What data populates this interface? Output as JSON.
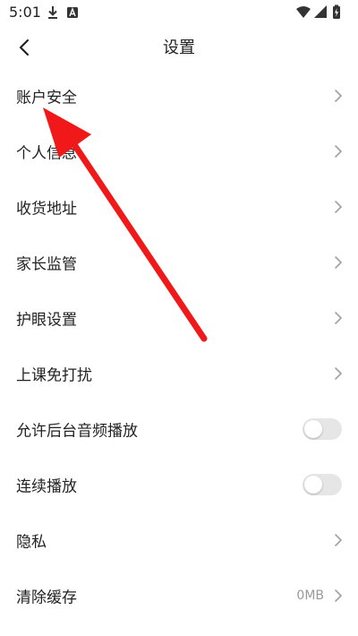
{
  "status_bar": {
    "time": "5:01",
    "icons": [
      "download-icon",
      "a-badge-icon",
      "wifi-icon",
      "signal-icon",
      "battery-charging-icon"
    ]
  },
  "header": {
    "back_icon": "chevron-left-icon",
    "title": "设置"
  },
  "settings": {
    "items": [
      {
        "label": "账户安全",
        "control": "chevron"
      },
      {
        "label": "个人信息",
        "control": "chevron"
      },
      {
        "label": "收货地址",
        "control": "chevron"
      },
      {
        "label": "家长监管",
        "control": "chevron"
      },
      {
        "label": "护眼设置",
        "control": "chevron"
      },
      {
        "label": "上课免打扰",
        "control": "chevron"
      },
      {
        "label": "允许后台音频播放",
        "control": "toggle",
        "enabled": false
      },
      {
        "label": "连续播放",
        "control": "toggle",
        "enabled": false
      },
      {
        "label": "隐私",
        "control": "chevron"
      },
      {
        "label": "清除缓存",
        "control": "chevron",
        "value": "0MB"
      }
    ]
  },
  "colors": {
    "annotation_arrow": "#f01818",
    "toggle_off": "#e6e6e6",
    "chevron": "#a0a0a0",
    "secondary_text": "#999999"
  }
}
